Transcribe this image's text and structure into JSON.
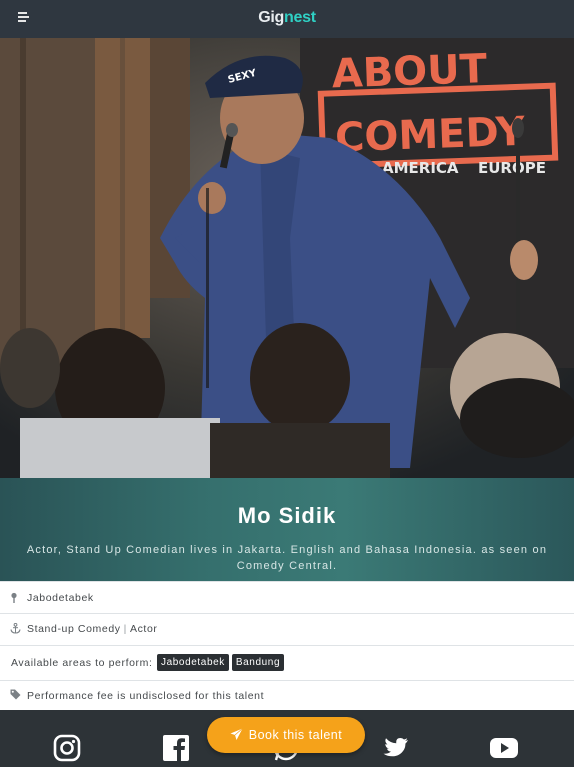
{
  "header": {
    "logo_part1": "Gig",
    "logo_part2": "nest"
  },
  "hero": {
    "banner_line1": "ABOUT",
    "banner_line2": "COMEDY",
    "banner_line3a": "AMERICA",
    "banner_line3b": "EUROPE",
    "cap_text": "SEXY"
  },
  "profile": {
    "name": "Mo Sidik",
    "bio": "Actor, Stand Up Comedian lives in Jakarta. English and Bahasa Indonesia. as seen on Comedy Central."
  },
  "details": {
    "location": "Jabodetabek",
    "category_primary": "Stand-up Comedy",
    "category_separator": "|",
    "category_secondary": "Actor",
    "areas_label": "Available areas to perform:",
    "areas": [
      "Jabodetabek",
      "Bandung"
    ],
    "fee_text": "Performance fee is undisclosed for this talent"
  },
  "actions": {
    "book_label": "Book this talent"
  },
  "social": [
    "instagram-icon",
    "facebook-icon",
    "whatsapp-icon",
    "twitter-icon",
    "youtube-icon"
  ],
  "colors": {
    "topbar": "#2f3740",
    "logo_accent": "#2fd0c4",
    "band": "#356f6d",
    "tag_bg": "#2b2f33",
    "book_button": "#f5a21a",
    "footer": "#2d3337"
  }
}
